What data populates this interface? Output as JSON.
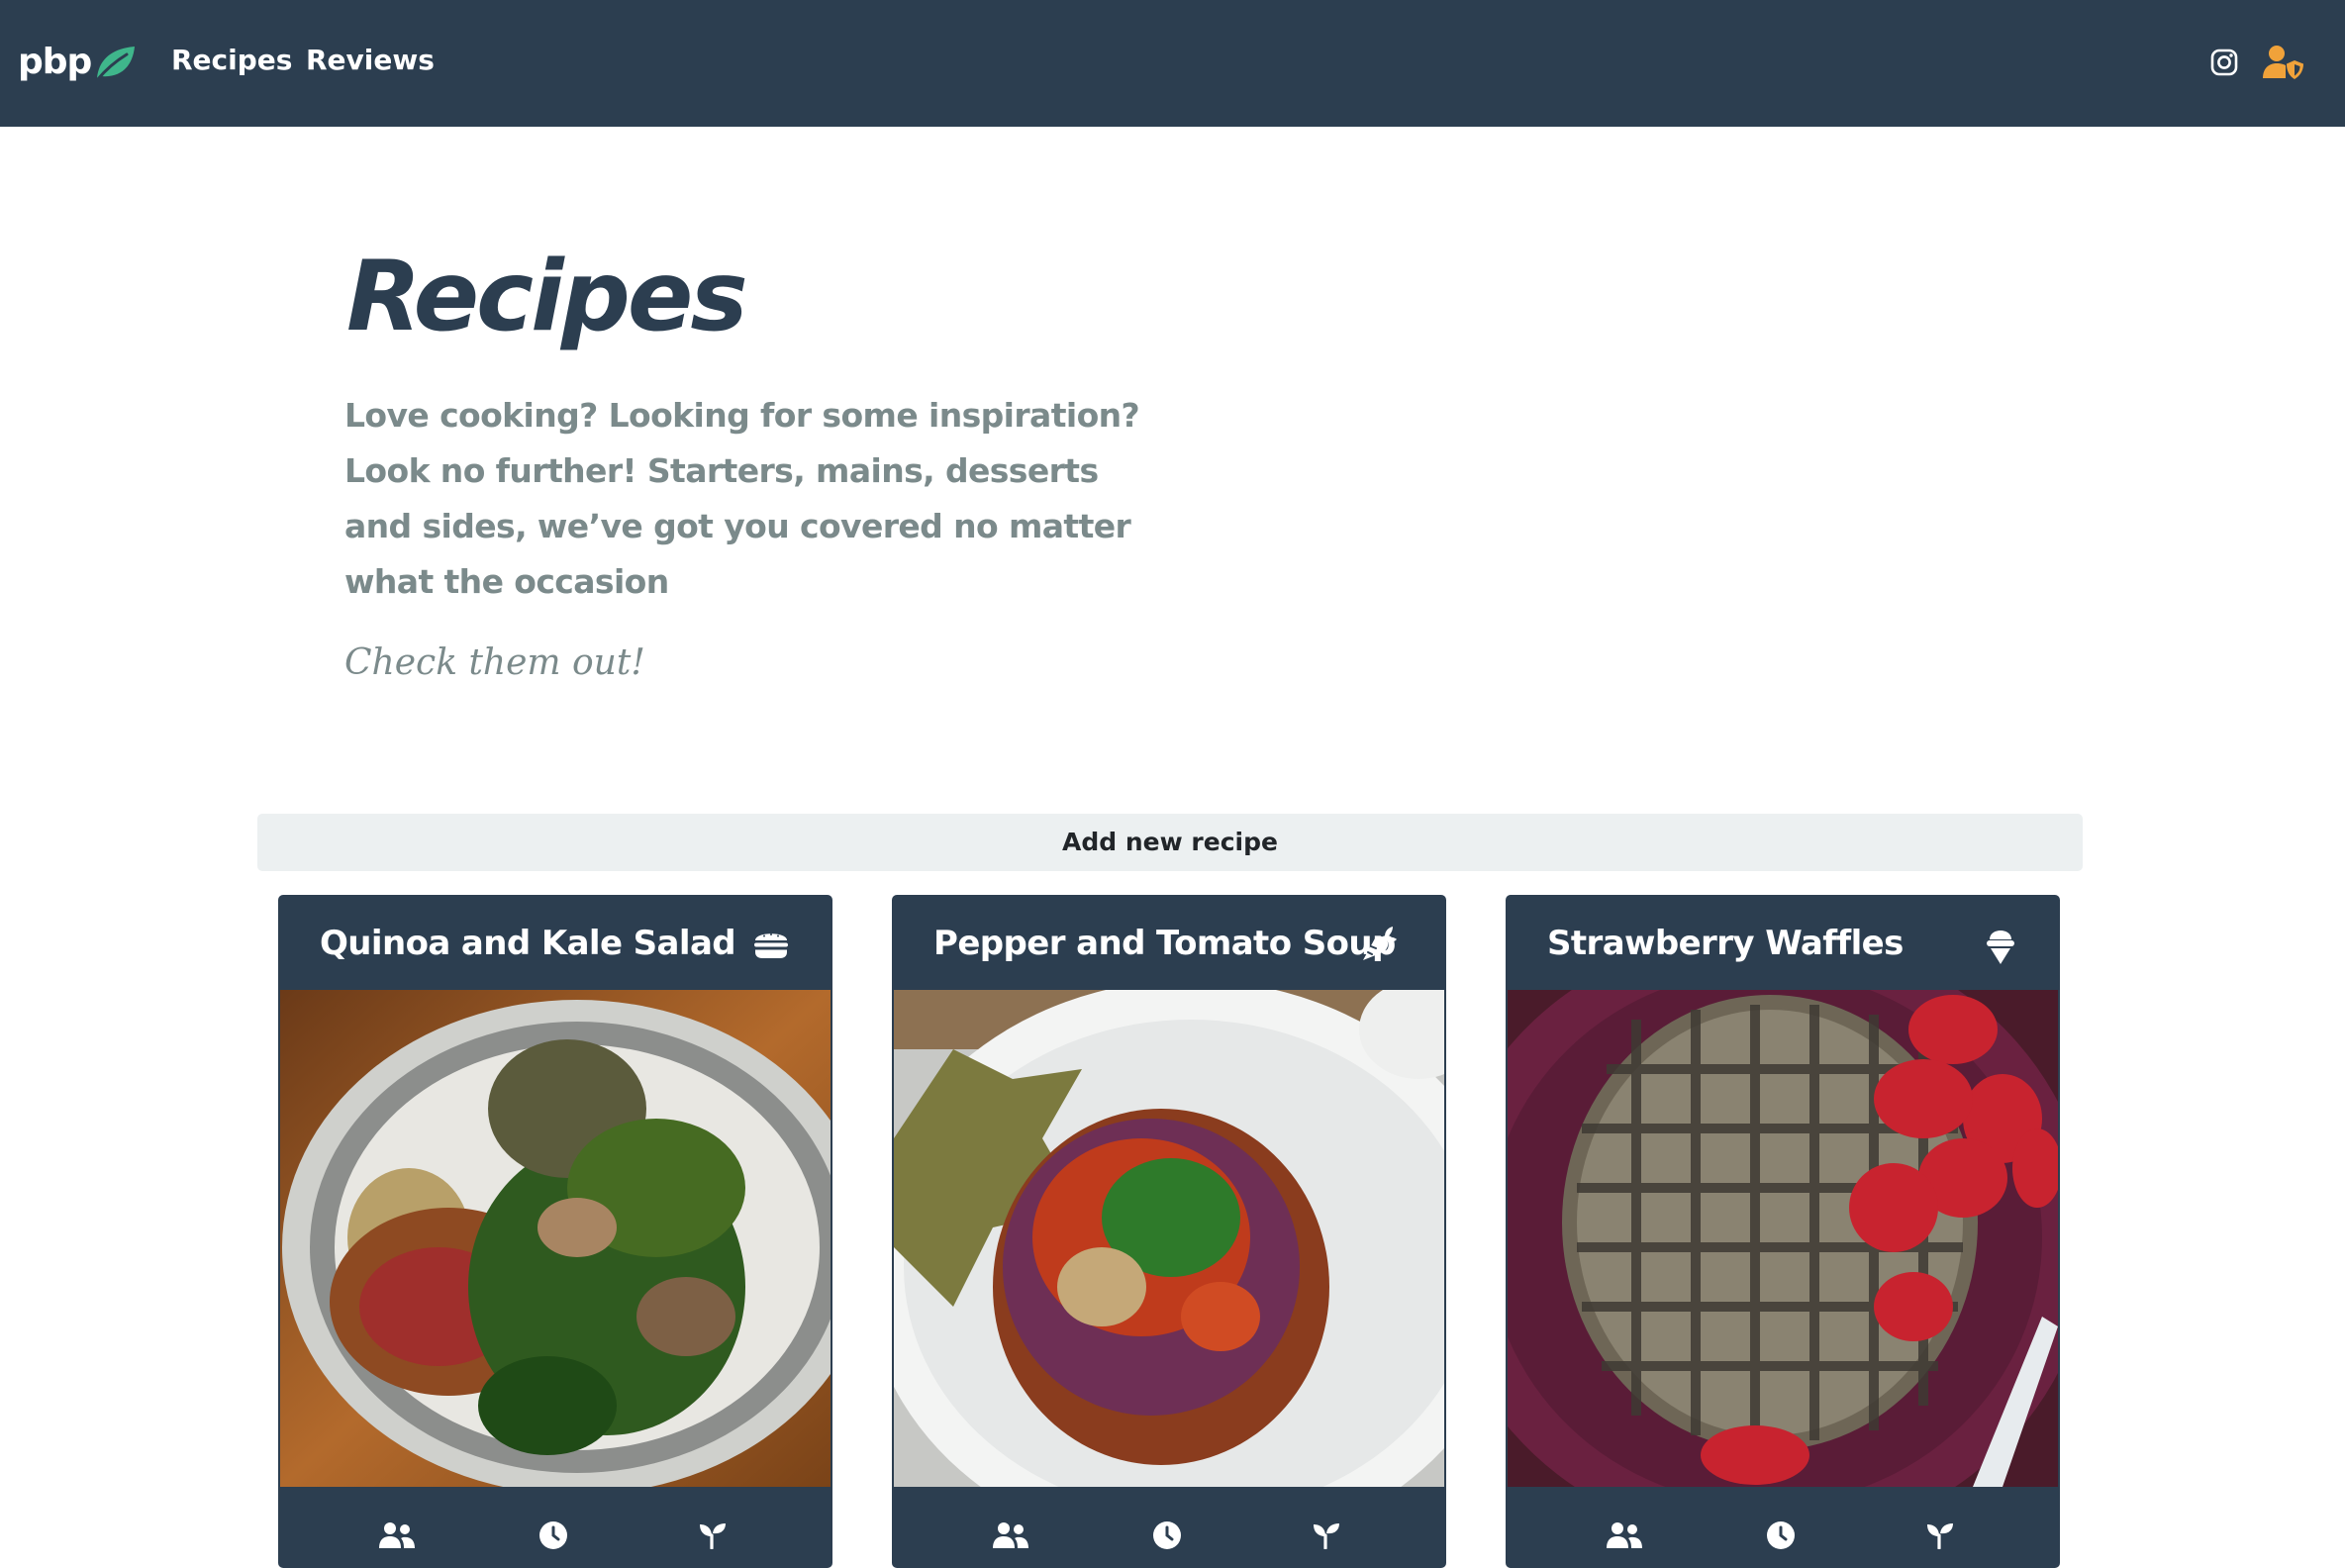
{
  "navbar": {
    "brand": "pbp",
    "links": [
      {
        "label": "Recipes"
      },
      {
        "label": "Reviews"
      }
    ],
    "icons": [
      "instagram-icon",
      "user-shield-icon"
    ],
    "colors": {
      "background": "#2c3e50",
      "leaf": "#3fb68b",
      "user_icon": "#f0a23a"
    }
  },
  "hero": {
    "title": "Recipes",
    "lead": "Love cooking? Looking for some inspiration? Look no further! Starters, mains, desserts and sides, we’ve got you covered no matter what the occasion",
    "cta": "Check them out!"
  },
  "add_button": {
    "label": "Add new recipe"
  },
  "recipes": [
    {
      "title": "Quinoa and Kale Salad",
      "category_icon": "burger-icon",
      "footer_icons": [
        "users-icon",
        "clock-icon",
        "seedling-icon"
      ]
    },
    {
      "title": "Pepper and Tomato Soup",
      "category_icon": "carrot-icon",
      "footer_icons": [
        "users-icon",
        "clock-icon",
        "seedling-icon"
      ]
    },
    {
      "title": "Strawberry Waffles",
      "category_icon": "ice-cream-icon",
      "footer_icons": [
        "users-icon",
        "clock-icon",
        "seedling-icon"
      ]
    }
  ]
}
